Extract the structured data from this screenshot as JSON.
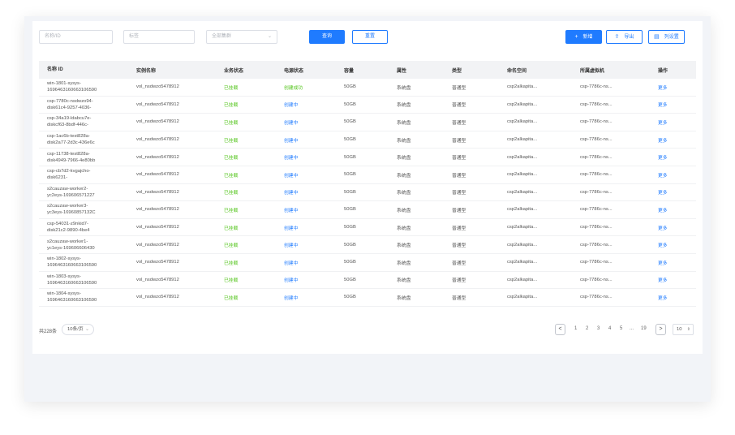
{
  "toolbar": {
    "name_input_placeholder": "名称/ID",
    "tag_input_placeholder": "标签",
    "select_value": "全部集群",
    "query_label": "查询",
    "reset_label": "重置",
    "add_label": "新增",
    "export_label": "导出",
    "columns_label": "列设置"
  },
  "table": {
    "headers": [
      "名称  ID",
      "实例名称",
      "业务状态",
      "电源状态",
      "容量",
      "属性",
      "类型",
      "命名空间",
      "所属虚拟机",
      "操作"
    ],
    "rows": [
      {
        "name1": "win-1801-sysys-",
        "name2": "1696463160663106590",
        "inst": "vol_nsdwzo5478912",
        "biz": "已挂载",
        "cs": "创建成功",
        "cap": "50GB",
        "attr": "系统盘",
        "type": "普通型",
        "ns": "csp2alkapita...",
        "vm": "csp-7786c-ns...",
        "op": "更多"
      },
      {
        "name1": "csp-7780c-nsdwzo94-",
        "name2": "disk61c4-9257-4036-",
        "inst": "vol_nsdwzo5478912",
        "biz": "已挂载",
        "cs": "创建中",
        "cap": "50GB",
        "attr": "系统盘",
        "type": "普通型",
        "ns": "csp2alkapita...",
        "vm": "csp-7786c-ns...",
        "op": "更多"
      },
      {
        "name1": "csp-34a19-ldabcu7e-",
        "name2": "diskcf63-8bdf-446c-",
        "inst": "vol_nsdwzo5478912",
        "biz": "已挂载",
        "cs": "创建中",
        "cap": "50GB",
        "attr": "系统盘",
        "type": "普通型",
        "ns": "csp2alkapita...",
        "vm": "csp-7786c-ns...",
        "op": "更多"
      },
      {
        "name1": "csp-1ac6b-test828a-",
        "name2": "disk2a77-2d3c-436e6c",
        "inst": "vol_nsdwzo5478912",
        "biz": "已挂载",
        "cs": "创建中",
        "cap": "50GB",
        "attr": "系统盘",
        "type": "普通型",
        "ns": "csp2alkapita...",
        "vm": "csp-7786c-ns...",
        "op": "更多"
      },
      {
        "name1": "csp-11738-test828a-",
        "name2": "disk4949-7966-4e80bb",
        "inst": "vol_nsdwzo5478912",
        "biz": "已挂载",
        "cs": "创建中",
        "cap": "50GB",
        "attr": "系统盘",
        "type": "普通型",
        "ns": "csp2alkapita...",
        "vm": "csp-7786c-ns...",
        "op": "更多"
      },
      {
        "name1": "csp-cb7d2-kvgajcho-",
        "name2": "disk6231-",
        "inst": "vol_nsdwzo5478912",
        "biz": "已挂载",
        "cs": "创建中",
        "cap": "50GB",
        "attr": "系统盘",
        "type": "普通型",
        "ns": "csp2alkapita...",
        "vm": "csp-7786c-ns...",
        "op": "更多"
      },
      {
        "name1": "s2cauzaw-worker2-",
        "name2": "yc2eys-169606571227",
        "inst": "vol_nsdwzo5478912",
        "biz": "已挂载",
        "cs": "创建中",
        "cap": "50GB",
        "attr": "系统盘",
        "type": "普通型",
        "ns": "csp2alkapita...",
        "vm": "csp-7786c-ns...",
        "op": "更多"
      },
      {
        "name1": "s2cauzaw-worker3-",
        "name2": "yc3eys-16960857132C",
        "inst": "vol_nsdwzo5478912",
        "biz": "已挂载",
        "cs": "创建中",
        "cap": "50GB",
        "attr": "系统盘",
        "type": "普通型",
        "ns": "csp2alkapita...",
        "vm": "csp-7786c-ns...",
        "op": "更多"
      },
      {
        "name1": "csp-54031-z9nkid7-",
        "name2": "disk21c2-9890-4be4",
        "inst": "vol_nsdwzo5478912",
        "biz": "已挂载",
        "cs": "创建中",
        "cap": "50GB",
        "attr": "系统盘",
        "type": "普通型",
        "ns": "csp2alkapita...",
        "vm": "csp-7786c-ns...",
        "op": "更多"
      },
      {
        "name1": "s2cauzaw-worker1-",
        "name2": "yc1eys-169606606430",
        "inst": "vol_nsdwzo5478912",
        "biz": "已挂载",
        "cs": "创建中",
        "cap": "50GB",
        "attr": "系统盘",
        "type": "普通型",
        "ns": "csp2alkapita...",
        "vm": "csp-7786c-ns...",
        "op": "更多"
      },
      {
        "name1": "win-1802-sysys-",
        "name2": "1696463160663106590",
        "inst": "vol_nsdwzo5478912",
        "biz": "已挂载",
        "cs": "创建中",
        "cap": "50GB",
        "attr": "系统盘",
        "type": "普通型",
        "ns": "csp2alkapita...",
        "vm": "csp-7786c-ns...",
        "op": "更多"
      },
      {
        "name1": "win-1803-sysys-",
        "name2": "1696463160663106590",
        "inst": "vol_nsdwzo5478912",
        "biz": "已挂载",
        "cs": "创建中",
        "cap": "50GB",
        "attr": "系统盘",
        "type": "普通型",
        "ns": "csp2alkapita...",
        "vm": "csp-7786c-ns...",
        "op": "更多"
      },
      {
        "name1": "win-1804-sysys-",
        "name2": "1696463160663106590",
        "inst": "vol_nsdwzo5478912",
        "biz": "已挂载",
        "cs": "创建中",
        "cap": "50GB",
        "attr": "系统盘",
        "type": "普通型",
        "ns": "csp2alkapita...",
        "vm": "csp-7786c-ns...",
        "op": "更多"
      }
    ]
  },
  "pagination": {
    "total": "共228条",
    "page_size": "10条/页",
    "pages": [
      "1",
      "2",
      "3",
      "4",
      "5",
      "...",
      "19"
    ],
    "jump_value": "10",
    "prev": "<",
    "next": ">"
  },
  "colors": {
    "primary": "#1f7bff",
    "success": "#52c41a"
  }
}
